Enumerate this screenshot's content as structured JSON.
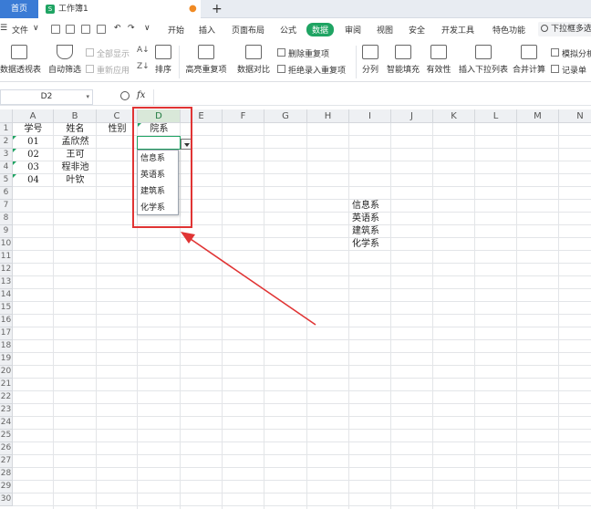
{
  "tabs": {
    "home": "首页",
    "workbook": "工作簿1"
  },
  "menu": {
    "file": "文件",
    "items": [
      "开始",
      "插入",
      "页面布局",
      "公式",
      "数据",
      "审阅",
      "视图",
      "安全",
      "开发工具",
      "特色功能"
    ],
    "active_index": 4,
    "search": "下拉框多选"
  },
  "ribbon": {
    "pivot": "数据透视表",
    "auto_filter": "自动筛选",
    "show_all": "全部显示",
    "reapply": "重新应用",
    "sort": "排序",
    "highlight_dup": "高亮重复项",
    "data_compare": "数据对比",
    "remove_dup": "删除重复项",
    "reject_dup": "拒绝录入重复项",
    "split": "分列",
    "smart_fill": "智能填充",
    "validity": "有效性",
    "insert_dropdown": "插入下拉列表",
    "consolidate": "合并计算",
    "simulate": "模拟分析",
    "record": "记录单"
  },
  "formula": {
    "name_box": "D2",
    "fx": "fx",
    "value": ""
  },
  "columns": [
    "A",
    "B",
    "C",
    "D",
    "E",
    "F",
    "G",
    "H",
    "I",
    "J",
    "K",
    "L",
    "M",
    "N"
  ],
  "rows": [
    "1",
    "2",
    "3",
    "4",
    "5",
    "6",
    "7",
    "8",
    "9",
    "10",
    "11",
    "12",
    "13",
    "14",
    "15",
    "16",
    "17",
    "18",
    "19",
    "20",
    "21",
    "22",
    "23",
    "24",
    "25",
    "26",
    "27",
    "28",
    "29",
    "30"
  ],
  "sheet": {
    "headers": {
      "a": "学号",
      "b": "姓名",
      "c": "性别",
      "d": "院系"
    },
    "records": [
      {
        "id": "01",
        "name": "孟欣然"
      },
      {
        "id": "02",
        "name": "王可"
      },
      {
        "id": "03",
        "name": "程非池"
      },
      {
        "id": "04",
        "name": "叶钦"
      }
    ],
    "source_list": [
      "信息系",
      "英语系",
      "建筑系",
      "化学系"
    ]
  },
  "dropdown": {
    "options": [
      "信息系",
      "英语系",
      "建筑系",
      "化学系"
    ]
  },
  "colors": {
    "accent": "#1fa463",
    "home_tab": "#3a7bd5",
    "annotation": "#e03434"
  }
}
